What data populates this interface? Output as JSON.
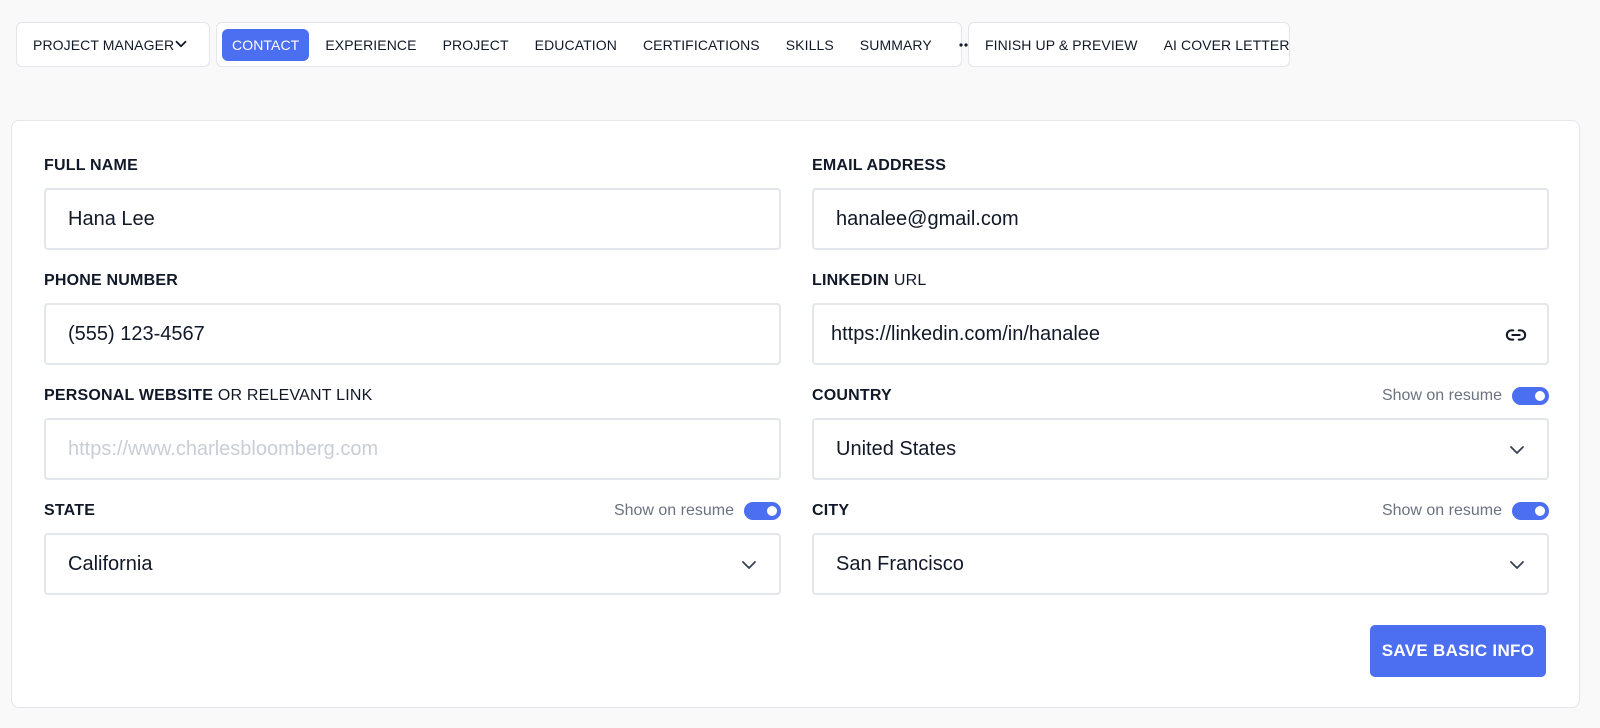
{
  "role_selector": {
    "label": "PROJECT MANAGER",
    "icon": "chevron-down-icon"
  },
  "tabs": [
    {
      "label": "CONTACT",
      "active": true
    },
    {
      "label": "EXPERIENCE"
    },
    {
      "label": "PROJECT"
    },
    {
      "label": "EDUCATION"
    },
    {
      "label": "CERTIFICATIONS"
    },
    {
      "label": "SKILLS"
    },
    {
      "label": "SUMMARY"
    }
  ],
  "more_tabs_icon": "more-horizontal-icon",
  "secondary_tabs": [
    {
      "label": "FINISH UP & PREVIEW"
    },
    {
      "label": "AI COVER LETTER"
    }
  ],
  "form": {
    "full_name": {
      "label": "FULL NAME",
      "value": "Hana Lee"
    },
    "email": {
      "label": "EMAIL ADDRESS",
      "value": "hanalee@gmail.com"
    },
    "phone": {
      "label": "PHONE NUMBER",
      "value": "(555) 123-4567"
    },
    "linkedin": {
      "label_bold": "LINKEDIN",
      "label_light": "URL",
      "value": "https://linkedin.com/in/hanalee",
      "icon": "link-icon"
    },
    "website": {
      "label_bold": "PERSONAL WEBSITE",
      "label_light": "OR RELEVANT LINK",
      "placeholder": "https://www.charlesbloomberg.com"
    },
    "country": {
      "label": "COUNTRY",
      "show_on_resume_label": "Show on resume",
      "show_on_resume": true,
      "value": "United States"
    },
    "state": {
      "label": "STATE",
      "show_on_resume_label": "Show on resume",
      "show_on_resume": true,
      "value": "California"
    },
    "city": {
      "label": "CITY",
      "show_on_resume_label": "Show on resume",
      "show_on_resume": true,
      "value": "San Francisco"
    }
  },
  "save_button": {
    "label": "SAVE BASIC INFO"
  },
  "colors": {
    "accent": "#4c6ef0",
    "border": "#e3e6ea",
    "background": "#f9f9fa",
    "muted_text": "#6b7280",
    "placeholder": "#c9ced6"
  }
}
